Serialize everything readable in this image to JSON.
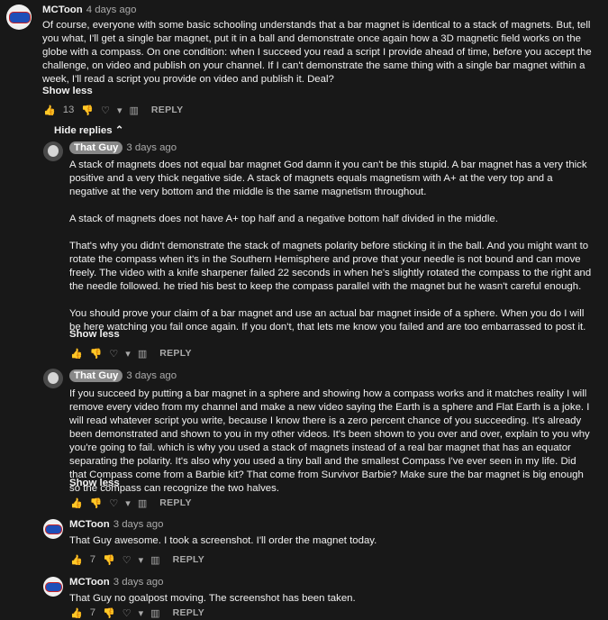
{
  "comments": [
    {
      "author": "MCToon",
      "time": "4 days ago",
      "paragraphs": [
        "Of course, everyone with some basic schooling understands that a bar magnet is identical to a stack of magnets.  But, tell you what, I'll get a single bar magnet, put it in a ball and demonstrate once again how a 3D magnetic field works on the globe with a compass.  On one condition: when I succeed you read a script I provide ahead of time, before you accept the challenge, on video and publish on your channel.  If I can't demonstrate the same thing with a single bar magnet within a week, I'll read a script you provide on video and publish it.  Deal?"
      ],
      "show_less": "Show less",
      "likes": "13",
      "reply": "REPLY"
    },
    {
      "author": "That Guy",
      "time": "3 days ago",
      "paragraphs": [
        "A stack of magnets does not equal bar magnet God damn it you can't be this stupid. A bar magnet has a very thick positive and a very thick negative side. A stack of magnets equals magnetism with A+ at the very top and a negative at the very bottom and the middle is the same magnetism throughout.",
        "A stack of magnets does not have A+ top half and a negative bottom half divided in the middle.",
        "That's why you didn't demonstrate the stack of magnets polarity before sticking it in the ball. And you might want to rotate the compass when it's in the Southern Hemisphere and prove that your needle is not bound and can move freely. The video with a knife sharpener failed 22 seconds in when he's slightly rotated the compass to the right and the needle followed. he tried his best to keep the compass parallel with the magnet but he wasn't careful enough.",
        "You should prove your claim of a bar magnet and use an actual bar magnet inside of a sphere. When you do I will be here watching you fail once again. If you don't, that lets me know you failed and are too embarrassed to post it."
      ],
      "show_less": "Show less",
      "likes": "",
      "reply": "REPLY"
    },
    {
      "author": "That Guy",
      "time": "3 days ago",
      "paragraphs": [
        "If you succeed by putting a bar magnet in a sphere and showing how a compass works and it matches reality I will remove every video from my channel and make a new video saying the Earth is a sphere and Flat Earth is a joke. I will read whatever script you write, because I know there is a zero percent chance of you succeeding. It's already been demonstrated and shown to you in my other videos. It's been shown to you over and over, explain to you why you're going to fail. which is why you used a stack of magnets instead of a real bar magnet that has an equator separating the polarity. It's also why you used a tiny ball and the smallest Compass I've ever seen in my life. Did that Compass come from a Barbie kit? That come from Survivor Barbie? Make sure the bar magnet is big enough so the compass can recognize the two halves."
      ],
      "show_less": "Show less",
      "likes": "",
      "reply": "REPLY"
    },
    {
      "author": "MCToon",
      "time": "3 days ago",
      "paragraphs": [
        "That Guy awesome.  I took a screenshot.  I'll order the magnet today."
      ],
      "likes": "7",
      "reply": "REPLY"
    },
    {
      "author": "MCToon",
      "time": "3 days ago",
      "paragraphs": [
        "That Guy no goalpost moving.  The screenshot has been taken."
      ],
      "likes": "7",
      "reply": "REPLY"
    }
  ],
  "hide_replies": "Hide replies",
  "icons": {
    "like": "thumbs-up-icon",
    "dislike": "thumbs-down-icon",
    "heart": "heart-icon",
    "dropdown": "dropdown-arrow-icon",
    "stats": "stats-icon"
  },
  "colors": {
    "like_active": "#3ea6ff",
    "bg": "#181818",
    "muted": "#aaaaaa"
  }
}
